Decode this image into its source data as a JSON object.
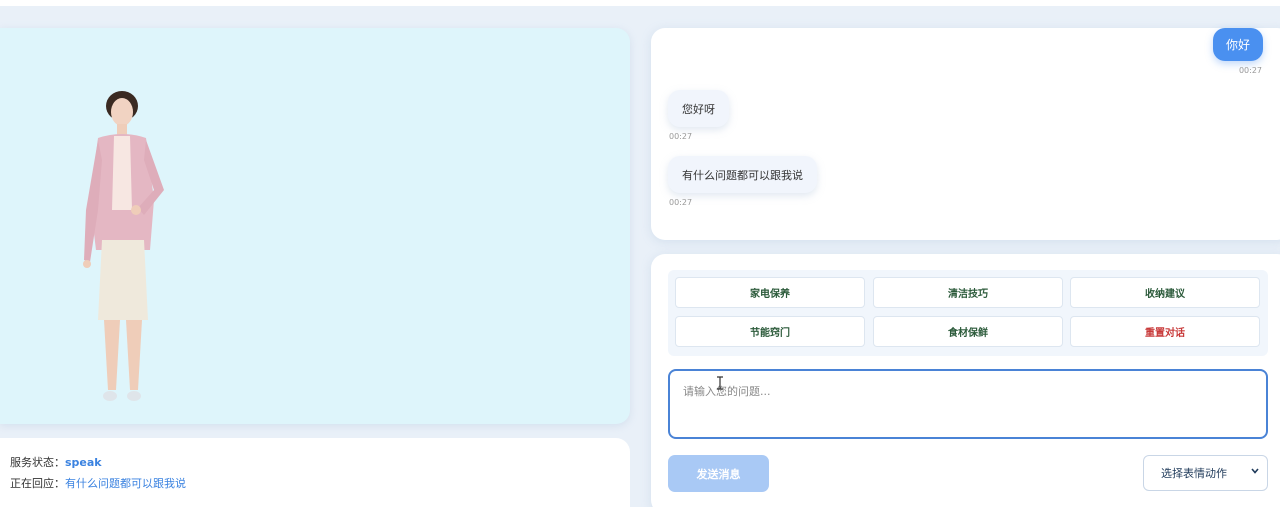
{
  "status": {
    "service_label": "服务状态：",
    "service_value": "speak",
    "reply_label": "正在回应：",
    "reply_value": "有什么问题都可以跟我说"
  },
  "chat": {
    "messages": [
      {
        "role": "user",
        "text": "你好",
        "time": "00:27"
      },
      {
        "role": "bot",
        "text": "您好呀",
        "time": "00:27"
      },
      {
        "role": "bot",
        "text": "有什么问题都可以跟我说",
        "time": "00:27"
      }
    ]
  },
  "quick_actions": [
    "家电保养",
    "清洁技巧",
    "收纳建议",
    "节能窍门",
    "食材保鲜",
    "重置对话"
  ],
  "input": {
    "placeholder": "请输入您的问题..."
  },
  "send_button": "发送消息",
  "expression_select": {
    "value": "选择表情动作"
  },
  "colors": {
    "accent": "#4a90f0",
    "avatar_bg": "#def5fb",
    "reset": "#c83a3a"
  },
  "icons": {
    "dropdown": "chevron-down-icon",
    "text_cursor": "text-cursor-icon"
  }
}
